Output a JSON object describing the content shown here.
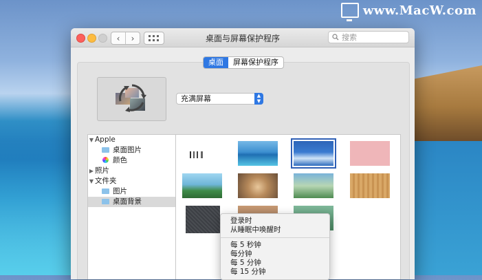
{
  "watermark": {
    "text": "www.MacW.com"
  },
  "window": {
    "title": "桌面与屏幕保护程序",
    "search_placeholder": "搜索"
  },
  "toolbar": {
    "back": "‹",
    "forward": "›"
  },
  "tabs": [
    {
      "label": "桌面",
      "active": true
    },
    {
      "label": "屏幕保护程序",
      "active": false
    }
  ],
  "fit_select": {
    "value": "充满屏幕"
  },
  "sidebar": {
    "items": [
      {
        "label": "Apple",
        "disclosure": "▼"
      },
      {
        "label": "桌面图片"
      },
      {
        "label": "颜色"
      },
      {
        "label": "照片",
        "disclosure": "▶"
      },
      {
        "label": "文件夹",
        "disclosure": "▼"
      },
      {
        "label": "图片"
      },
      {
        "label": "桌面背景",
        "selected": true
      }
    ]
  },
  "context_menu": {
    "items": [
      "登录时",
      "从睡眠中唤醒时",
      "每 5 秒钟",
      "每分钟",
      "每 5 分钟",
      "每 15 分钟"
    ]
  },
  "colors": {
    "accent": "#2f78e3",
    "selection_outline": "#2f5fb5"
  }
}
